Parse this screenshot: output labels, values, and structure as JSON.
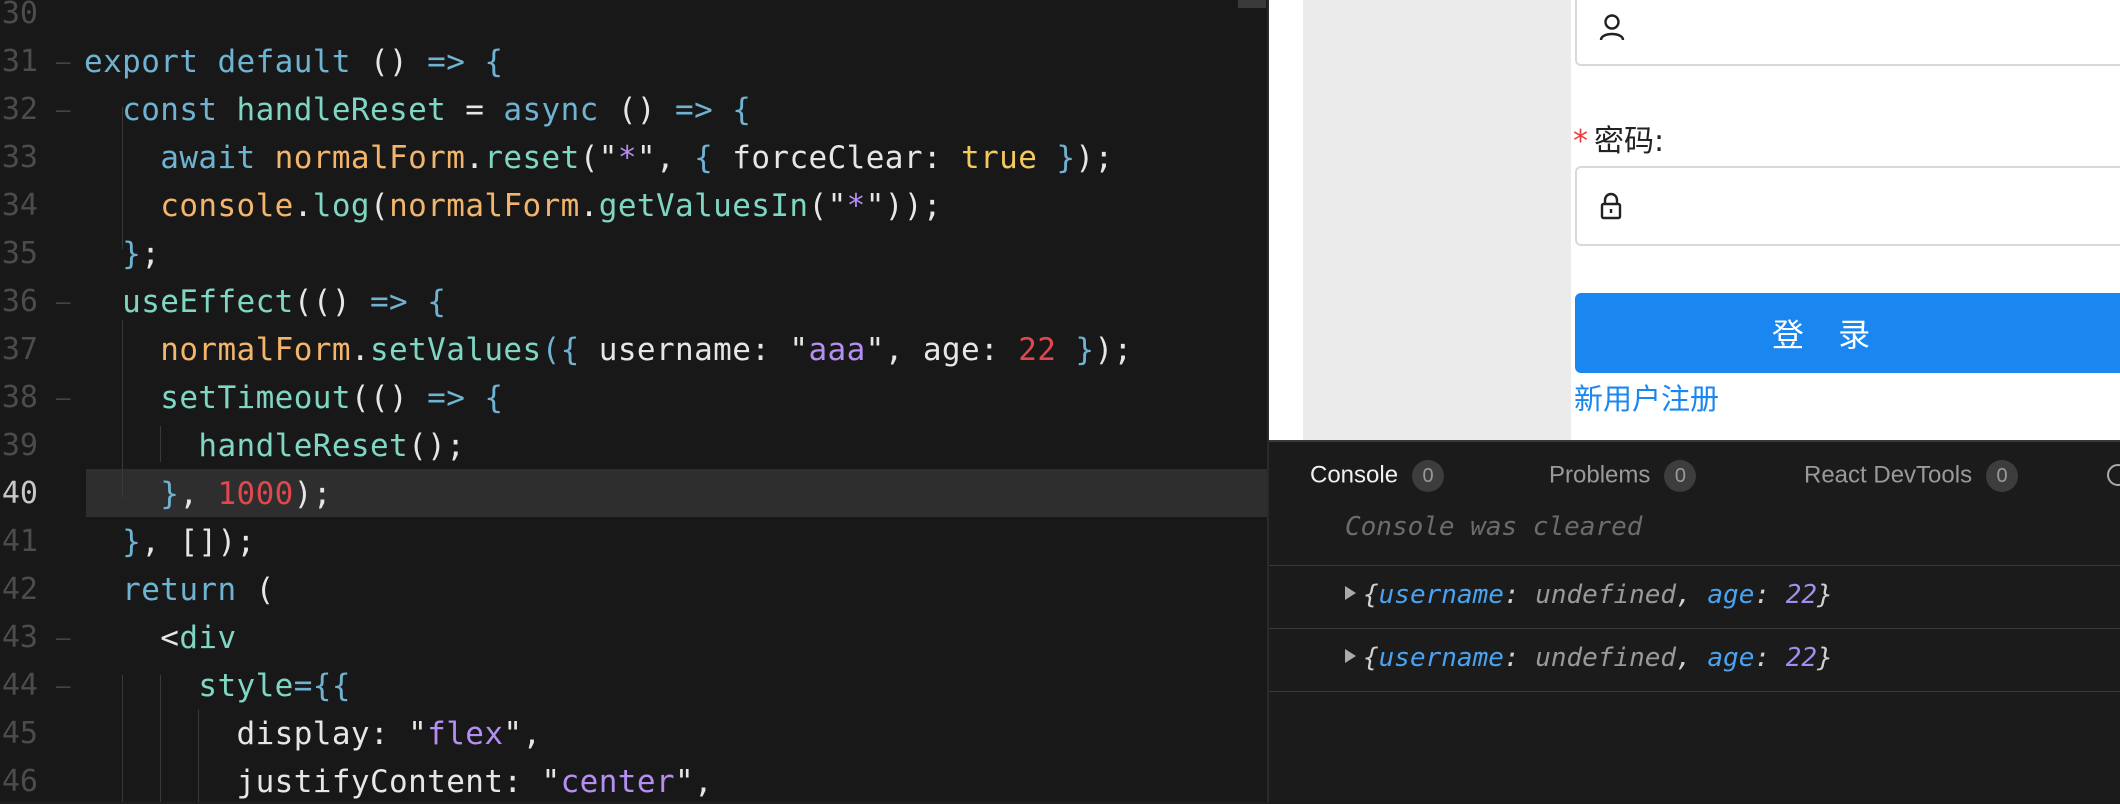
{
  "editor": {
    "lines": [
      {
        "num": "30"
      },
      {
        "num": "31"
      },
      {
        "num": "32"
      },
      {
        "num": "33"
      },
      {
        "num": "34"
      },
      {
        "num": "35"
      },
      {
        "num": "36"
      },
      {
        "num": "37"
      },
      {
        "num": "38"
      },
      {
        "num": "39"
      },
      {
        "num": "40"
      },
      {
        "num": "41"
      },
      {
        "num": "42"
      },
      {
        "num": "43"
      },
      {
        "num": "44"
      },
      {
        "num": "45"
      },
      {
        "num": "46"
      }
    ],
    "code": {
      "l31_a": "export default",
      "l31_b": " () ",
      "l31_c": "=>",
      "l31_d": " {",
      "l32_a": "  const ",
      "l32_b": "handleReset",
      "l32_c": " = ",
      "l32_d": "async",
      "l32_e": " () ",
      "l32_f": "=>",
      "l32_g": " {",
      "l33_a": "    await ",
      "l33_b": "normalForm",
      "l33_c": ".",
      "l33_d": "reset",
      "l33_e": "(\"",
      "l33_f": "*",
      "l33_g": "\", ",
      "l33_h": "{",
      "l33_i": " forceClear: ",
      "l33_j": "true",
      "l33_k": " }",
      "l33_l": ");",
      "l34_a": "    ",
      "l34_b": "console",
      "l34_c": ".",
      "l34_d": "log",
      "l34_e": "(",
      "l34_f": "normalForm",
      "l34_g": ".",
      "l34_h": "getValuesIn",
      "l34_i": "(\"",
      "l34_j": "*",
      "l34_k": "\"));",
      "l35_a": "  ",
      "l35_b": "}",
      "l35_c": ";",
      "l36_a": "  ",
      "l36_b": "useEffect",
      "l36_c": "(() ",
      "l36_d": "=>",
      "l36_e": " {",
      "l37_a": "    ",
      "l37_b": "normalForm",
      "l37_c": ".",
      "l37_d": "setValues",
      "l37_e": "({",
      "l37_f": " username: \"",
      "l37_g": "aaa",
      "l37_h": "\", age: ",
      "l37_i": "22",
      "l37_j": " }",
      "l37_k": ");",
      "l38_a": "    ",
      "l38_b": "setTimeout",
      "l38_c": "(() ",
      "l38_d": "=>",
      "l38_e": " {",
      "l39_a": "      ",
      "l39_b": "handleReset",
      "l39_c": "();",
      "l40_a": "    ",
      "l40_b": "}",
      "l40_c": ", ",
      "l40_d": "1000",
      "l40_e": ");",
      "l41_a": "  ",
      "l41_b": "}",
      "l41_c": ", []);",
      "l42_a": "  ",
      "l42_b": "return",
      "l42_c": " (",
      "l43_a": "    <",
      "l43_b": "div",
      "l44_a": "      ",
      "l44_b": "style",
      "l44_c": "=",
      "l44_d": "{{",
      "l45_a": "        display: \"",
      "l45_b": "flex",
      "l45_c": "\",",
      "l46_a": "        justifyContent: \"",
      "l46_b": "center",
      "l46_c": "\","
    }
  },
  "preview": {
    "password_required_mark": "*",
    "password_label": "密码:",
    "login_button": "登 录",
    "register_link": "新用户注册"
  },
  "devtools": {
    "tabs": [
      {
        "label": "Console",
        "count": "0"
      },
      {
        "label": "Problems",
        "count": "0"
      },
      {
        "label": "React DevTools",
        "count": "0"
      }
    ],
    "cleared_message": "Console was cleared",
    "logs": [
      {
        "open": "{",
        "k1": "username",
        "sep1": ": ",
        "v1": "undefined",
        "comma": ", ",
        "k2": "age",
        "sep2": ": ",
        "v2": "22",
        "close": "}"
      },
      {
        "open": "{",
        "k1": "username",
        "sep1": ": ",
        "v1": "undefined",
        "comma": ", ",
        "k2": "age",
        "sep2": ": ",
        "v2": "22",
        "close": "}"
      }
    ]
  },
  "colors": {
    "editor_bg": "#181818",
    "keyword": "#6fb3d2",
    "function": "#7fd6c2",
    "object": "#f2b56b",
    "string": "#b48ef0",
    "number": "#e0474f",
    "boolean": "#f4c95d",
    "primary_button": "#1a87f0"
  }
}
